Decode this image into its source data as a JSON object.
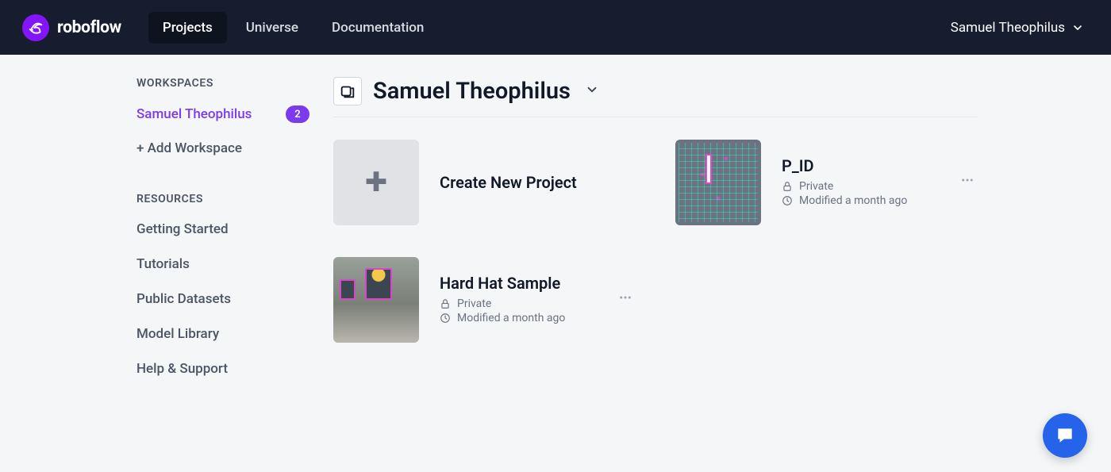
{
  "header": {
    "brand": "roboflow",
    "nav": {
      "projects": "Projects",
      "universe": "Universe",
      "documentation": "Documentation"
    },
    "user_name": "Samuel Theophilus"
  },
  "sidebar": {
    "workspaces_heading": "WORKSPACES",
    "workspace": {
      "name": "Samuel Theophilus",
      "count": "2"
    },
    "add_workspace": "+ Add Workspace",
    "resources_heading": "RESOURCES",
    "resources": {
      "getting_started": "Getting Started",
      "tutorials": "Tutorials",
      "public_datasets": "Public Datasets",
      "model_library": "Model Library",
      "help_support": "Help & Support"
    }
  },
  "main": {
    "workspace_title": "Samuel Theophilus",
    "create_label": "Create New Project",
    "projects": [
      {
        "name": "P_ID",
        "visibility": "Private",
        "modified": "Modified a month ago"
      },
      {
        "name": "Hard Hat Sample",
        "visibility": "Private",
        "modified": "Modified a month ago"
      }
    ]
  }
}
